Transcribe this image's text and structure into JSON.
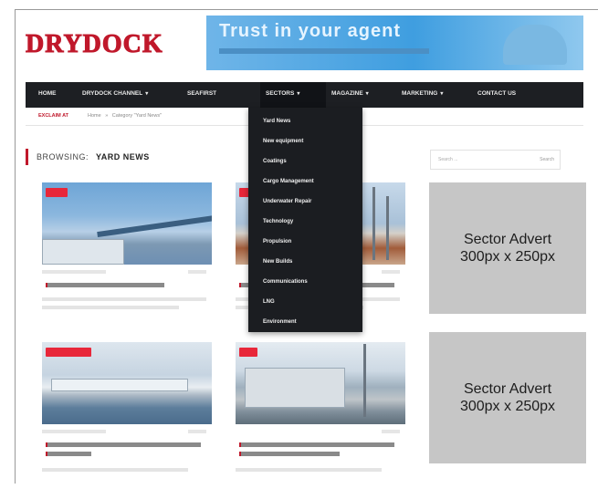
{
  "header": {
    "logo": "DRYDOCK",
    "banner_headline": "Trust in your agent"
  },
  "nav": {
    "items": [
      {
        "label": "HOME",
        "caret": false
      },
      {
        "label": "DRYDOCK CHANNEL",
        "caret": true
      },
      {
        "label": "SEAFIRST",
        "caret": false
      },
      {
        "label": "SECTORS",
        "caret": true
      },
      {
        "label": "MAGAZINE",
        "caret": true
      },
      {
        "label": "MARKETING",
        "caret": true
      },
      {
        "label": "CONTACT US",
        "caret": false
      }
    ],
    "caret_glyph": "▾"
  },
  "breadcrumb": {
    "ticker": "EXCLAIM AT",
    "home": "Home",
    "separator": "»",
    "current": "Category \"Yard News\""
  },
  "browsing": {
    "label": "BROWSING:",
    "value": "YARD NEWS"
  },
  "sectors_menu": [
    "Yard News",
    "New equipment",
    "Coatings",
    "Cargo Management",
    "Underwater Repair",
    "Technology",
    "Propulsion",
    "New Builds",
    "Communications",
    "LNG",
    "Environment"
  ],
  "sidebar": {
    "search_placeholder": "Search ...",
    "search_button": "Search",
    "adverts": [
      {
        "line1": "Sector Advert",
        "line2": "300px x 250px"
      },
      {
        "line1": "Sector Advert",
        "line2": "300px x 250px"
      }
    ]
  },
  "colors": {
    "brand_red": "#c0182b",
    "nav_bg": "#1d1f23",
    "advert_bg": "#c6c6c6"
  }
}
